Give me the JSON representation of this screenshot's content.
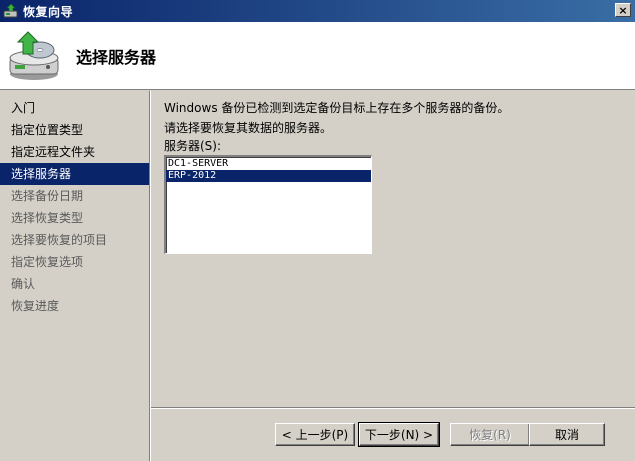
{
  "window": {
    "title": "恢复向导",
    "close_glyph": "×"
  },
  "header": {
    "page_title": "选择服务器",
    "icon": "backup-drive-restore-icon"
  },
  "sidebar": {
    "items": [
      {
        "label": "入门",
        "state": "normal"
      },
      {
        "label": "指定位置类型",
        "state": "normal"
      },
      {
        "label": "指定远程文件夹",
        "state": "normal"
      },
      {
        "label": "选择服务器",
        "state": "selected"
      },
      {
        "label": "选择备份日期",
        "state": "disabled"
      },
      {
        "label": "选择恢复类型",
        "state": "disabled"
      },
      {
        "label": "选择要恢复的项目",
        "state": "disabled"
      },
      {
        "label": "指定恢复选项",
        "state": "disabled"
      },
      {
        "label": "确认",
        "state": "disabled"
      },
      {
        "label": "恢复进度",
        "state": "disabled"
      }
    ]
  },
  "main": {
    "description_line1": "Windows 备份已检测到选定备份目标上存在多个服务器的备份。",
    "description_line2": "请选择要恢复其数据的服务器。",
    "list_label": "服务器(S):",
    "servers": [
      {
        "name": "DC1-SERVER",
        "selected": false
      },
      {
        "name": "ERP-2012",
        "selected": true
      }
    ]
  },
  "buttons": {
    "back": "< 上一步(P)",
    "next": "下一步(N) >",
    "recover": "恢复(R)",
    "cancel": "取消"
  },
  "colors": {
    "selection": "#0a246a",
    "titlebar_start": "#0a246a",
    "titlebar_end": "#3a6ea5",
    "dialog_face": "#d4d0c8"
  }
}
